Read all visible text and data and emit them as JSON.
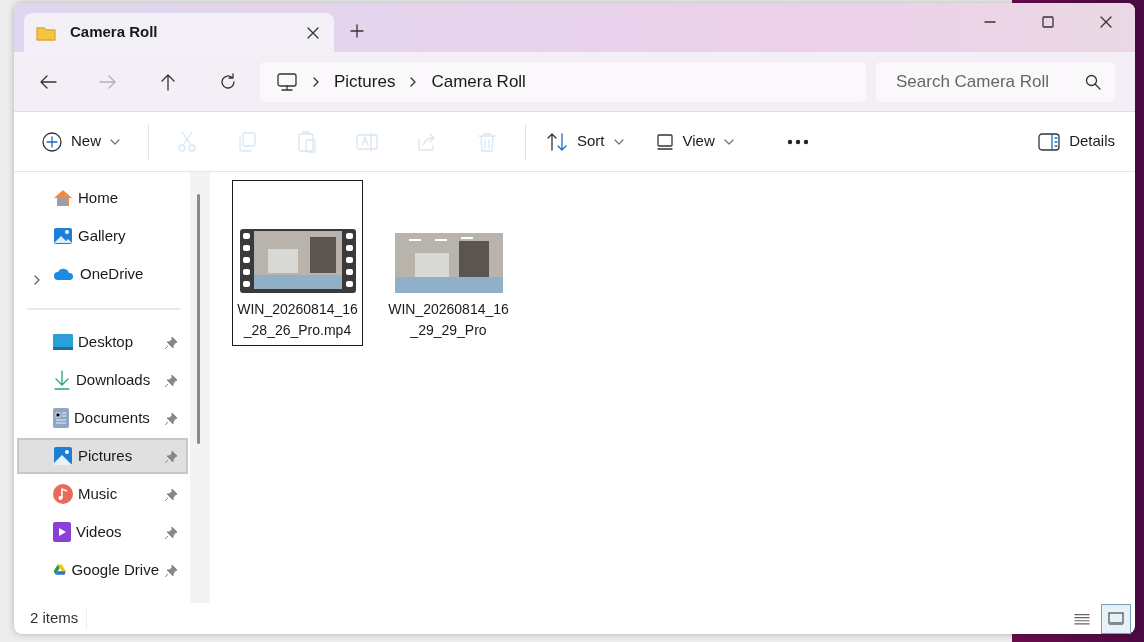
{
  "tabs": [
    {
      "label": "Camera Roll",
      "selected": true
    }
  ],
  "nav": [
    {
      "kind": "back",
      "disabled": false
    },
    {
      "kind": "forward",
      "disabled": true
    },
    {
      "kind": "up",
      "disabled": false
    },
    {
      "kind": "refresh",
      "disabled": false
    }
  ],
  "address": {
    "crumbs": [
      "Pictures",
      "Camera Roll"
    ]
  },
  "search": {
    "placeholder": "Search Camera Roll"
  },
  "toolbar": {
    "actions": [
      {
        "kind": "new",
        "label": "New",
        "disabled": false
      },
      {
        "kind": "cut",
        "disabled": true
      },
      {
        "kind": "copy",
        "disabled": true
      },
      {
        "kind": "paste",
        "disabled": true
      },
      {
        "kind": "rename",
        "disabled": true
      },
      {
        "kind": "share",
        "disabled": true
      },
      {
        "kind": "delete",
        "disabled": true
      },
      {
        "kind": "sort",
        "label": "Sort",
        "disabled": false
      },
      {
        "kind": "view",
        "label": "View",
        "disabled": false
      },
      {
        "kind": "more",
        "disabled": false
      }
    ],
    "details": {
      "label": "Details"
    }
  },
  "sidebar": {
    "groups": [
      {
        "items": [
          {
            "kind": "home",
            "label": "Home",
            "pinned": false,
            "selected": false
          },
          {
            "kind": "gallery",
            "label": "Gallery",
            "pinned": false,
            "selected": false
          },
          {
            "kind": "cloud",
            "label": "OneDrive",
            "pinned": false,
            "selected": false,
            "expanded": false
          }
        ]
      },
      {
        "items": [
          {
            "kind": "desktop",
            "label": "Desktop",
            "pinned": true,
            "selected": false
          },
          {
            "kind": "downloads",
            "label": "Downloads",
            "pinned": true,
            "selected": false
          },
          {
            "kind": "documents",
            "label": "Documents",
            "pinned": true,
            "selected": false
          },
          {
            "kind": "pictures",
            "label": "Pictures",
            "pinned": true,
            "selected": true
          },
          {
            "kind": "music",
            "label": "Music",
            "pinned": true,
            "selected": false
          },
          {
            "kind": "videos",
            "label": "Videos",
            "pinned": true,
            "selected": false
          },
          {
            "kind": "drive",
            "label": "Google Drive",
            "pinned": true,
            "selected": false
          }
        ]
      }
    ]
  },
  "files": [
    {
      "kind": "video",
      "name": "WIN_20260814_16_28_26_Pro.mp4",
      "selected": true
    },
    {
      "kind": "photo",
      "name": "WIN_20260814_16_29_29_Pro",
      "selected": false
    }
  ],
  "status_bar": {
    "count": "2 items",
    "views": [
      {
        "kind": "details",
        "selected": false
      },
      {
        "kind": "tiles",
        "selected": true
      }
    ]
  }
}
